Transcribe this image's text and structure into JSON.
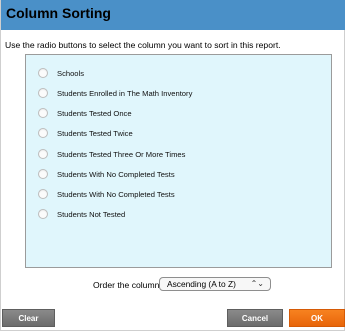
{
  "dialog": {
    "title": "Column Sorting",
    "instructions": "Use the radio buttons to select the column you want to sort in this report."
  },
  "options": [
    {
      "label": "Schools",
      "selected": false
    },
    {
      "label": "Students Enrolled in The Math Inventory",
      "selected": false
    },
    {
      "label": "Students Tested Once",
      "selected": false
    },
    {
      "label": "Students Tested Twice",
      "selected": false
    },
    {
      "label": "Students Tested Three Or More Times",
      "selected": false
    },
    {
      "label": "Students With No Completed Tests",
      "selected": false
    },
    {
      "label": "Students With No Completed Tests",
      "selected": false
    },
    {
      "label": "Students Not Tested",
      "selected": false
    }
  ],
  "order": {
    "label": "Order the column",
    "selected": "Ascending (A to Z)",
    "arrows": "⌃⌄"
  },
  "buttons": {
    "clear": "Clear",
    "cancel": "Cancel",
    "ok": "OK"
  },
  "colors": {
    "title_bar": "#4a90c8",
    "list_background": "#e0f6fc",
    "ok_button": "#f07418",
    "gray_button": "#7a7a7a"
  }
}
